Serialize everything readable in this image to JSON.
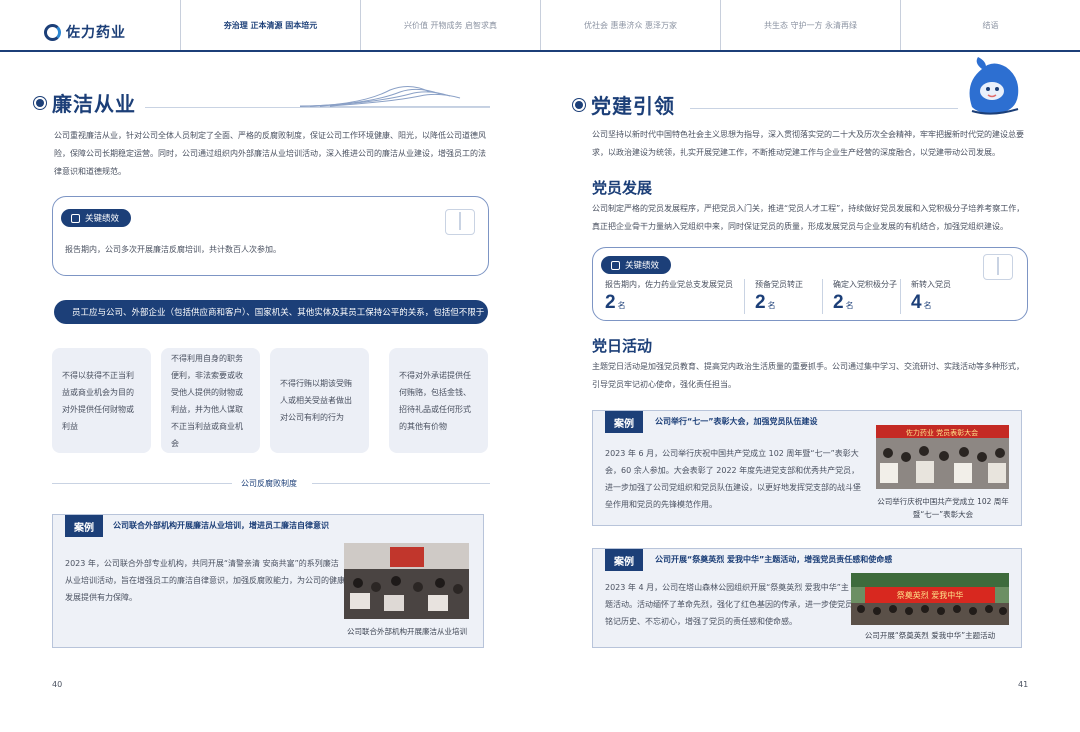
{
  "header": {
    "logo_text": "佐力药业",
    "tabs": [
      "夯治理 正本清源 固本培元",
      "兴价值 开物成务 启智求真",
      "优社会 惠患济众 惠泽万家",
      "共生态 守护一方 永清再绿",
      "结语"
    ]
  },
  "left": {
    "title": "廉洁从业",
    "intro": "公司重视廉洁从业，针对公司全体人员制定了全面、严格的反腐败制度，保证公司工作环境健康、阳光，以降低公司道德风险，保障公司长期稳定运营。同时，公司通过组织内外部廉洁从业培训活动，深入推进公司的廉洁从业建设，增强员工的法律意识和道德规范。",
    "kpi_label": "关键绩效",
    "kpi_text": "报告期内，公司多次开展廉洁反腐培训，共计数百人次参加。",
    "banner": "员工应与公司、外部企业（包括供应商和客户）、国家机关、其他实体及其员工保持公平的关系，包括但不限于",
    "cards": [
      "不得以获得不正当利益或商业机会为目的对外提供任何财物或利益",
      "不得利用自身的职务便利，非法索要或收受他人提供的财物或利益，并为他人谋取不正当利益或商业机会",
      "不得行贿以期该受贿人或相关受益者做出对公司有利的行为",
      "不得对外承诺提供任何贿赂，包括金钱、招待礼品或任何形式的其他有价物"
    ],
    "system_label": "公司反腐败制度",
    "case": {
      "tag": "案例",
      "heading": "公司联合外部机构开展廉洁从业培训，增进员工廉洁自律意识",
      "text": "2023 年，公司联合外部专业机构，共同开展“清警亲清 安商共富”的系列廉洁从业培训活动，旨在增强员工的廉洁自律意识，加强反腐败能力，为公司的健康发展提供有力保障。",
      "caption": "公司联合外部机构开展廉洁从业培训"
    },
    "page": "40"
  },
  "right": {
    "title": "党建引领",
    "intro": "公司坚持以新时代中国特色社会主义思想为指导，深入贯彻落实党的二十大及历次全会精神，牢牢把握新时代党的建设总要求，以政治建设为统领，扎实开展党建工作，不断推动党建工作与企业生产经营的深度融合，以党建带动公司发展。",
    "sub1": "党员发展",
    "sub1_text": "公司制定严格的党员发展程序，严把党员入门关，推进“党员人才工程”，持续做好党员发展和入党积极分子培养考察工作，真正把企业骨干力量纳入党组织中来，同时保证党员的质量，形成发展党员与企业发展的有机结合，加强党组织建设。",
    "kpi_label": "关键绩效",
    "stats": [
      {
        "label": "报告期内，佐力药业党总支发展党员",
        "value": "2",
        "unit": "名"
      },
      {
        "label": "预备党员转正",
        "value": "2",
        "unit": "名"
      },
      {
        "label": "确定入党积极分子",
        "value": "2",
        "unit": "名"
      },
      {
        "label": "新转入党员",
        "value": "4",
        "unit": "名"
      }
    ],
    "sub2": "党日活动",
    "sub2_text": "主题党日活动是加强党员教育、提高党内政治生活质量的重要抓手。公司通过集中学习、交流研讨、实践活动等多种形式，引导党员牢记初心使命，强化责任担当。",
    "case1": {
      "tag": "案例",
      "heading": "公司举行“七一”表彰大会，加强党员队伍建设",
      "text": "2023 年 6 月，公司举行庆祝中国共产党成立 102 周年暨“七一”表彰大会，60 余人参加。大会表彰了 2022 年度先进党支部和优秀共产党员，进一步加强了公司党组织和党员队伍建设，以更好地发挥党支部的战斗堡垒作用和党员的先锋模范作用。",
      "caption": "公司举行庆祝中国共产党成立 102 周年暨“七一”表彰大会",
      "photo_banner": "佐力药业 党员表彰大会"
    },
    "case2": {
      "tag": "案例",
      "heading": "公司开展“祭奠英烈 爱我中华”主题活动，增强党员责任感和使命感",
      "text": "2023 年 4 月，公司在塔山森林公园组织开展“祭奠英烈 爱我中华”主题活动。活动缅怀了革命先烈，强化了红色基因的传承，进一步使党员铭记历史、不忘初心，增强了党员的责任感和使命感。",
      "caption": "公司开展“祭奠英烈 爱我中华”主题活动",
      "photo_banner": "祭奠英烈 爱我中华"
    },
    "page": "41"
  }
}
